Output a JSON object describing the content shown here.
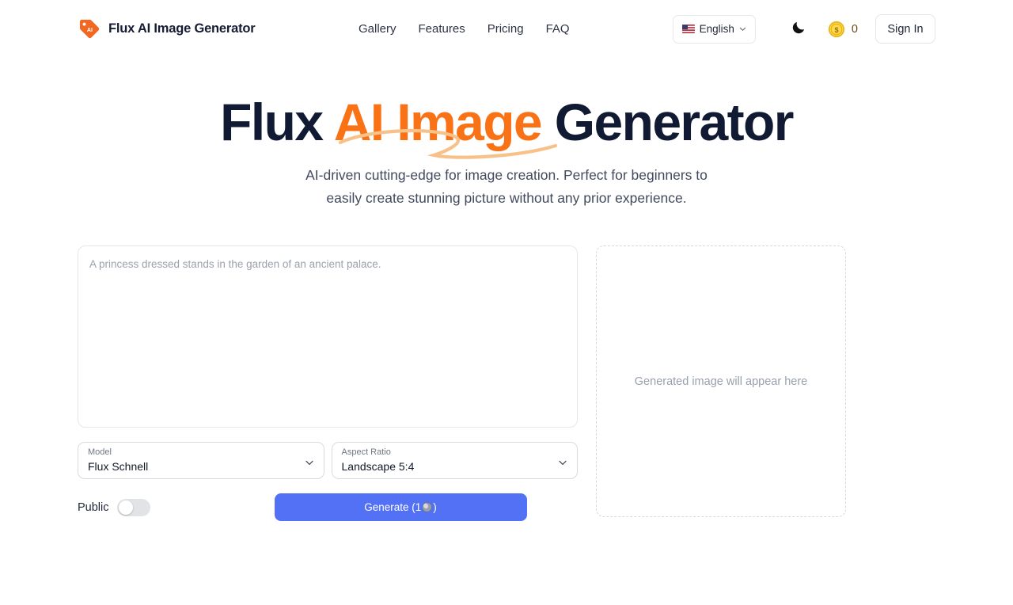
{
  "brand": {
    "name": "Flux AI Image Generator",
    "logo_icon": "ai-tag-logo-icon",
    "logo_text": "AI",
    "logo_color": "#f97316"
  },
  "nav": {
    "items": [
      {
        "label": "Gallery"
      },
      {
        "label": "Features"
      },
      {
        "label": "Pricing"
      },
      {
        "label": "FAQ"
      }
    ]
  },
  "header_right": {
    "language": {
      "label": "English",
      "flag_icon": "us-flag-icon",
      "chevron_icon": "chevron-down-icon"
    },
    "theme_toggle": {
      "icon": "moon-icon"
    },
    "credits": {
      "icon": "dollar-coin-icon",
      "count": "0",
      "count_color": "#6b4a17"
    },
    "sign_in": {
      "label": "Sign In"
    }
  },
  "hero": {
    "title_part1": "Flux ",
    "title_highlight": "AI Image",
    "title_part2": " Generator",
    "highlight_color": "#f97316",
    "title_color": "#111a33",
    "underline_icon": "swoosh-underline-icon",
    "subtitle_line1": "AI-driven cutting-edge for image creation. Perfect for beginners to",
    "subtitle_line2": "easily create stunning picture without any prior experience."
  },
  "generator": {
    "prompt": {
      "value": "",
      "placeholder": "A princess dressed stands in the garden of an ancient palace."
    },
    "model": {
      "label": "Model",
      "value": "Flux Schnell",
      "chevron_icon": "chevron-down-icon"
    },
    "aspect_ratio": {
      "label": "Aspect Ratio",
      "value": "Landscape 5:4",
      "chevron_icon": "chevron-down-icon"
    },
    "public_toggle": {
      "label": "Public",
      "state": "off"
    },
    "generate_button": {
      "label_prefix": "Generate (1",
      "label_suffix": ")",
      "coin_icon": "coin-icon",
      "color": "#5271f5"
    }
  },
  "preview": {
    "placeholder_text": "Generated image will appear here"
  }
}
